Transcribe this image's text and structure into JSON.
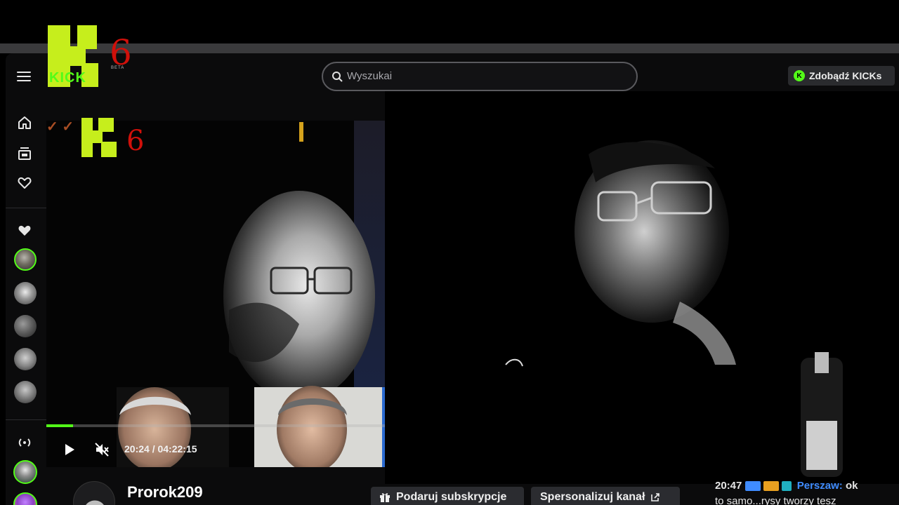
{
  "header": {
    "search_placeholder": "Wyszukai",
    "kicks_button": "Zdobądź KICKs",
    "logo_text": "KICK",
    "logo_overlay_number": "6",
    "logo_beta": "BETA"
  },
  "sidebar": {
    "nav": [
      "home-icon",
      "browse-icon",
      "following-icon"
    ],
    "followed_channels": [
      {
        "name": "channel-1",
        "live": true
      },
      {
        "name": "channel-2",
        "live": false
      },
      {
        "name": "channel-3",
        "live": false
      },
      {
        "name": "channel-4",
        "live": false
      },
      {
        "name": "channel-5",
        "live": false
      },
      {
        "name": "channel-6",
        "live": true
      },
      {
        "name": "channel-7",
        "live": true
      }
    ]
  },
  "player": {
    "time_current": "20:24",
    "time_separator": "/",
    "time_total": "04:22:15",
    "progress": 0.078,
    "muted": true
  },
  "channel": {
    "name": "Prorok209"
  },
  "actions": {
    "gift_sub": "Podaruj subskrypcje",
    "customize": "Spersonalizuj kanał"
  },
  "chat": {
    "time": "20:47",
    "username": "Perszaw:",
    "message_start": "ok",
    "line2": "to samo...rysy tworzy tesz"
  },
  "colors": {
    "brand": "#53fc18",
    "logo_block": "#c6ee1c",
    "overlay_red": "#d0100a"
  }
}
